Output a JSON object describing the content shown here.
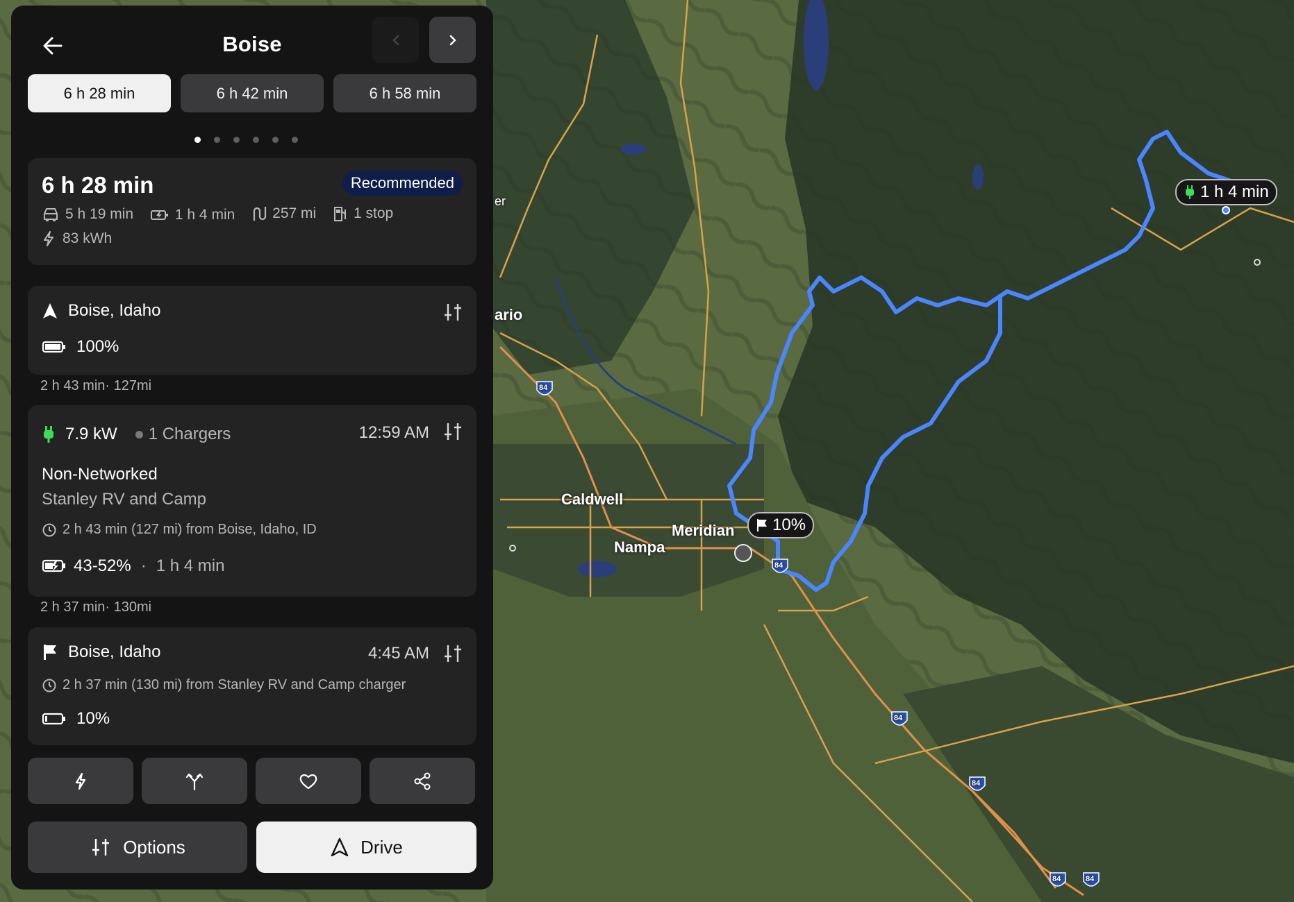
{
  "header": {
    "title": "Boise"
  },
  "route_tabs": [
    "6 h 28 min",
    "6 h 42 min",
    "6 h 58 min"
  ],
  "route_page": {
    "count": 6,
    "active": 1
  },
  "summary": {
    "duration": "6 h 28 min",
    "badge": "Recommended",
    "drive_time": "5 h 19 min",
    "charge_time": "1 h 4 min",
    "distance": "257 mi",
    "stops": "1 stop",
    "energy": "83 kWh"
  },
  "origin": {
    "name": "Boise, Idaho",
    "battery": "100%",
    "battery_level": 1.0
  },
  "segment1": "2 h 43 min· 127mi",
  "charger": {
    "power": "7.9 kW",
    "chargers": "1 Chargers",
    "arrival_time": "12:59 AM",
    "network": "Non-Networked",
    "name": "Stanley RV and Camp",
    "from": "2 h 43 min (127 mi) from Boise, Idaho, ID",
    "charge_range": "43-52%",
    "charge_duration": "1 h 4 min",
    "separator": "·"
  },
  "segment2": "2 h 37 min· 130mi",
  "destination": {
    "name": "Boise, Idaho",
    "arrival_time": "4:45 AM",
    "from": "2 h 37 min (130 mi) from Stanley RV and Camp charger",
    "battery": "10%",
    "battery_level": 0.1
  },
  "buttons": {
    "options": "Options",
    "drive": "Drive"
  },
  "map": {
    "cities": [
      "Caldwell",
      "Meridian",
      "Nampa"
    ],
    "partial_labels": [
      "er",
      "ario"
    ],
    "highway": "84",
    "charge_bubble": "1 h 4 min",
    "arrival_bubble": "10%"
  },
  "colors": {
    "panel": "#141414",
    "card": "#232323",
    "button": "#3a3a3c",
    "badge": "#0f1d4a",
    "route": "#4a86ff",
    "charger_green": "#3ddc58",
    "terrain_dark": "#2f3f2b",
    "terrain_light": "#5b6e40",
    "road": "#d8a24a"
  },
  "icons": [
    "back-arrow-icon",
    "chevron-left-icon",
    "chevron-right-icon",
    "car-icon",
    "battery-charging-icon",
    "route-icon",
    "fuel-station-icon",
    "bolt-icon",
    "navigation-arrow-icon",
    "battery-icon",
    "adjust-icon",
    "plug-icon",
    "clock-icon",
    "flag-icon",
    "fork-icon",
    "heart-icon",
    "share-icon"
  ]
}
